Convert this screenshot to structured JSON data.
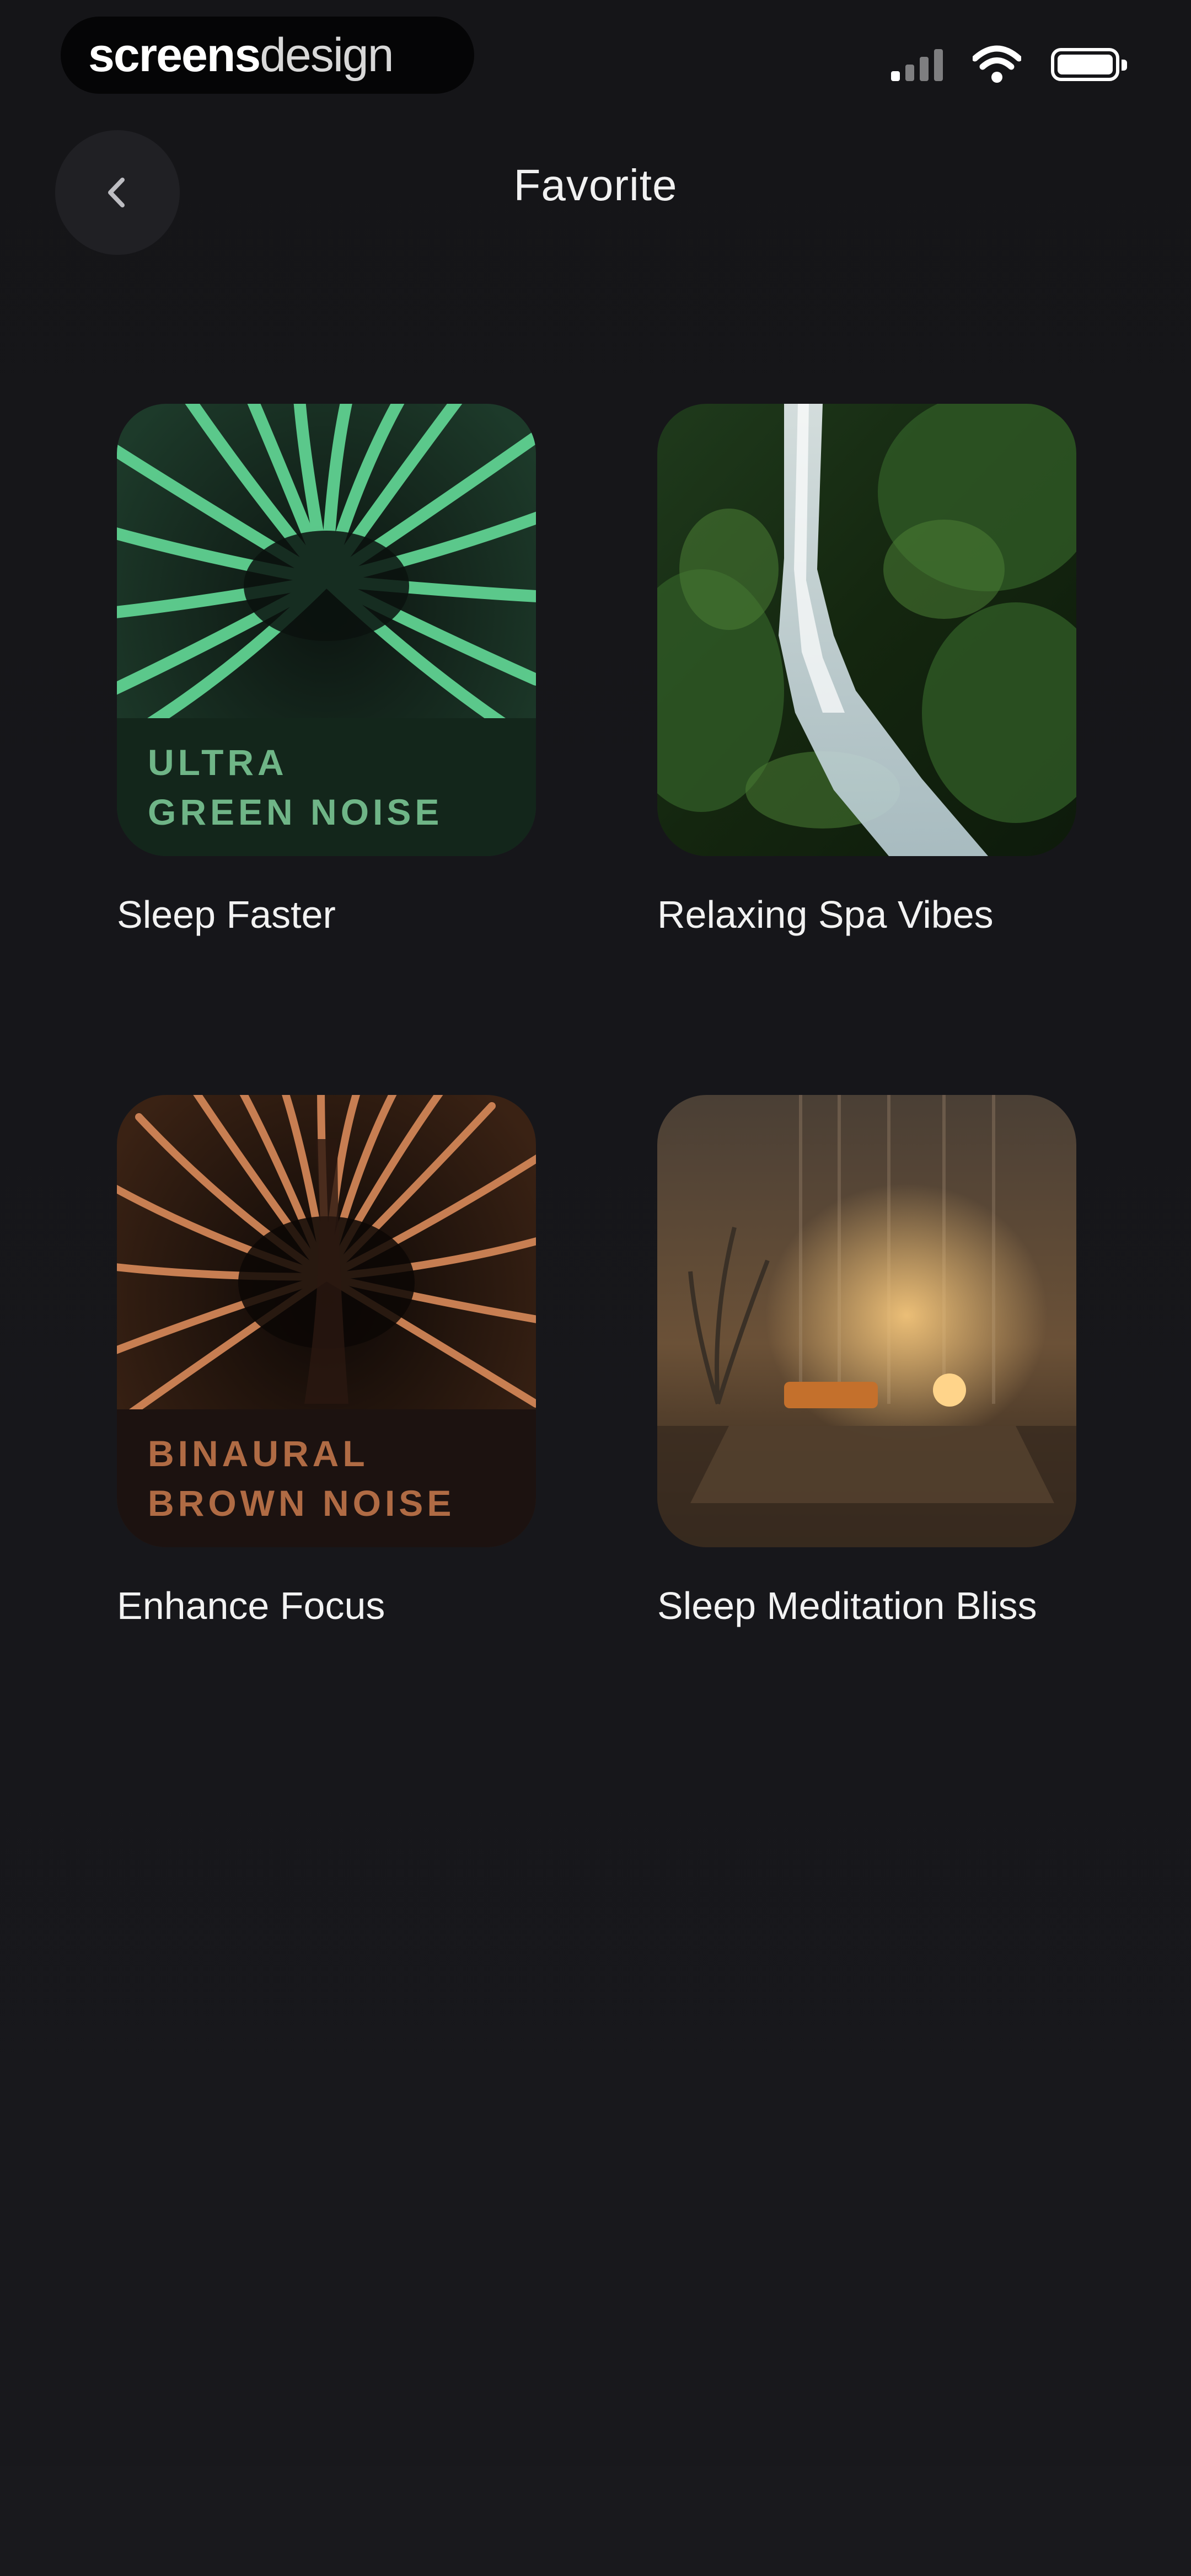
{
  "status_bar": {
    "brand_part1": "screens",
    "brand_part2": "design",
    "icons": [
      "signal-icon",
      "wifi-icon",
      "battery-icon"
    ]
  },
  "header": {
    "title": "Favorite",
    "back_icon": "chevron-left-icon"
  },
  "favorites": [
    {
      "label": "Sleep Faster",
      "cover_line1": "ULTRA",
      "cover_line2": "GREEN NOISE",
      "cover_color": "#6fb587"
    },
    {
      "label": "Relaxing Spa Vibes"
    },
    {
      "label": "Enhance Focus",
      "cover_line1": "BINAURAL",
      "cover_line2": "BROWN NOISE",
      "cover_color": "#b06b44"
    },
    {
      "label": "Sleep Meditation Bliss"
    }
  ],
  "colors": {
    "background": "#151518",
    "text": "#f2f2f2",
    "back_button": "#202024"
  }
}
